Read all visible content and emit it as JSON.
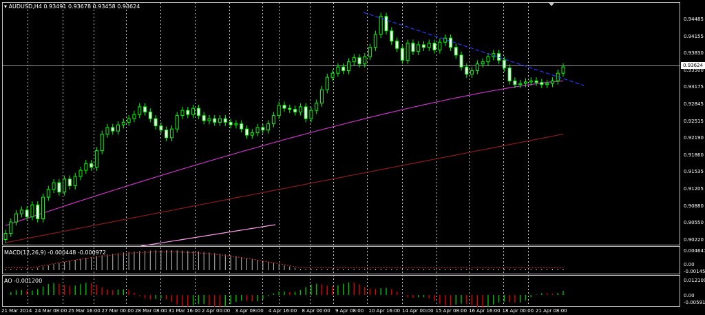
{
  "header": {
    "symbol": "AUDUSD,H4",
    "ohlc": "0.93491 0.93678 0.93458 0.93624"
  },
  "colors": {
    "background": "#000000",
    "bull_candle": "#00ff00",
    "bear_candle": "#ffffff",
    "ma_fast": "#c832c8",
    "ma_slow": "#8b1a1a",
    "trendline_down": "#1e3cff",
    "trendline_pink": "#ff9bf0",
    "grid": "#c8c8c8",
    "macd_hist": "#c0c0c0",
    "macd_signal": "#e03030",
    "ao_up": "#00c000",
    "ao_down": "#e00000"
  },
  "main_panel": {
    "current_price_label": "0.93624",
    "price_labels": [
      "0.94485",
      "0.94155",
      "0.93830",
      "0.93500",
      "0.93175",
      "0.92845",
      "0.92515",
      "0.92190",
      "0.91860",
      "0.91535",
      "0.91205",
      "0.90880",
      "0.90550",
      "0.90220"
    ]
  },
  "macd_panel": {
    "label": "MACD(12,26,9) -0.000448 -0.000972",
    "axis_labels": [
      "0.004647",
      "0.00",
      "-0.00145"
    ]
  },
  "ao_panel": {
    "label": "AO -0.001200",
    "axis_labels": [
      "0.012109",
      "0.00",
      "-0.00591"
    ]
  },
  "time_axis": {
    "labels": [
      "21 Mar 2014",
      "24 Mar 08:00",
      "25 Mar 16:00",
      "27 Mar 00:00",
      "28 Mar 08:00",
      "31 Mar 16:00",
      "2 Apr 00:00",
      "3 Apr 08:00",
      "4 Apr 16:00",
      "8 Apr 00:00",
      "9 Apr 08:00",
      "10 Apr 16:00",
      "14 Apr 00:00",
      "15 Apr 08:00",
      "16 Apr 16:00",
      "18 Apr 00:00",
      "21 Apr 08:00"
    ]
  },
  "chart_data": {
    "type": "candlestick",
    "symbol": "AUDUSD",
    "timeframe": "H4",
    "ylim": [
      0.9022,
      0.9465
    ],
    "close_series": [
      0.904,
      0.9062,
      0.9078,
      0.9085,
      0.9072,
      0.9095,
      0.9068,
      0.911,
      0.9125,
      0.9138,
      0.912,
      0.9145,
      0.9132,
      0.915,
      0.9162,
      0.9175,
      0.9168,
      0.92,
      0.9232,
      0.9245,
      0.9238,
      0.925,
      0.9255,
      0.9262,
      0.927,
      0.9285,
      0.9275,
      0.9262,
      0.9248,
      0.924,
      0.9225,
      0.9242,
      0.9268,
      0.9278,
      0.927,
      0.9282,
      0.9268,
      0.9258,
      0.9262,
      0.9255,
      0.9262,
      0.9255,
      0.925,
      0.9252,
      0.9242,
      0.923,
      0.9235,
      0.9245,
      0.924,
      0.9252,
      0.9268,
      0.9288,
      0.9282,
      0.928,
      0.9275,
      0.9285,
      0.9262,
      0.9278,
      0.9292,
      0.9318,
      0.9342,
      0.935,
      0.9362,
      0.9355,
      0.9372,
      0.938,
      0.9368,
      0.9382,
      0.94,
      0.9425,
      0.946,
      0.9432,
      0.9412,
      0.9398,
      0.9375,
      0.9408,
      0.9392,
      0.9405,
      0.94,
      0.9408,
      0.9395,
      0.941,
      0.9418,
      0.94,
      0.9385,
      0.9362,
      0.9348,
      0.9355,
      0.9368,
      0.9372,
      0.9382,
      0.9388,
      0.9375,
      0.936,
      0.9335,
      0.9328,
      0.933,
      0.9333,
      0.9335,
      0.9332,
      0.9328,
      0.933,
      0.9335,
      0.935,
      0.9362
    ],
    "ma_fast": {
      "from": 0.9055,
      "to": 0.9335
    },
    "ma_slow": {
      "from": 0.9022,
      "to": 0.9232
    },
    "macd": {
      "label": "MACD(12,26,9)",
      "main": -0.000448,
      "signal": -0.000972
    },
    "ao": {
      "label": "AO",
      "value": -0.0012
    },
    "x_labels": [
      "21 Mar 2014",
      "24 Mar 08:00",
      "25 Mar 16:00",
      "27 Mar 00:00",
      "28 Mar 08:00",
      "31 Mar 16:00",
      "2 Apr 00:00",
      "3 Apr 08:00",
      "4 Apr 16:00",
      "8 Apr 00:00",
      "9 Apr 08:00",
      "10 Apr 16:00",
      "14 Apr 00:00",
      "15 Apr 08:00",
      "16 Apr 16:00",
      "18 Apr 00:00",
      "21 Apr 08:00"
    ]
  }
}
